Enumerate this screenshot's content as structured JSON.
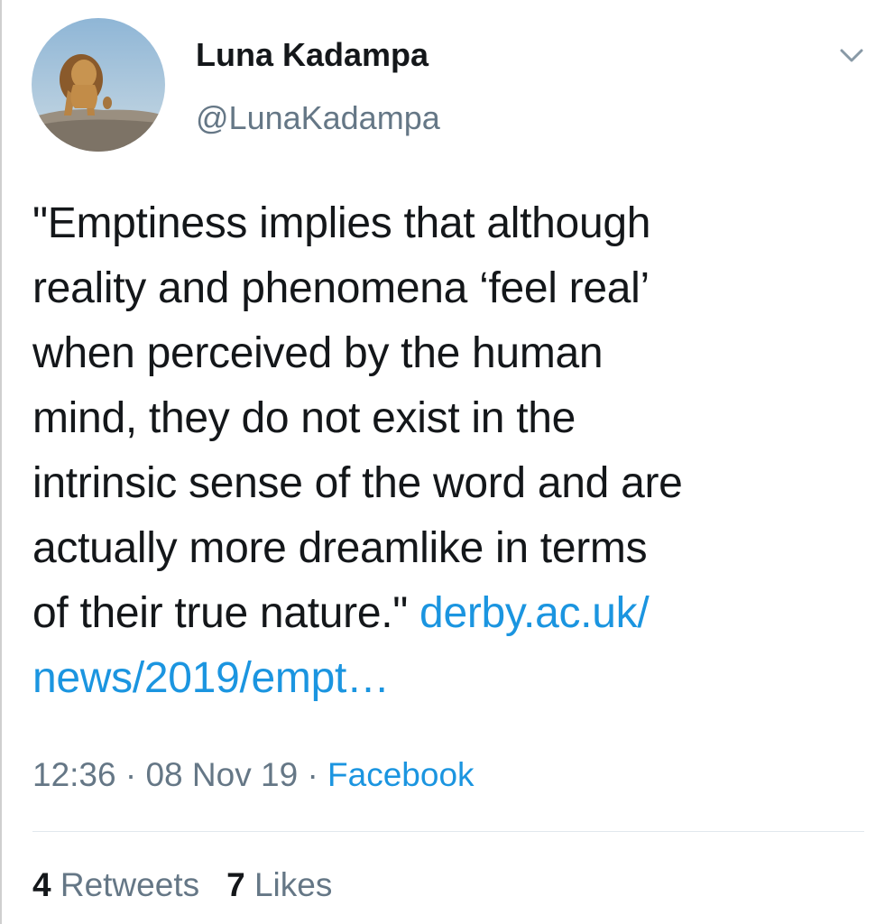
{
  "author": {
    "display_name": "Luna Kadampa",
    "handle": "@LunaKadampa",
    "avatar_icon": "lion-photo-avatar"
  },
  "menu_icon": "chevron-down-icon",
  "tweet": {
    "lines": [
      "\"Emptiness implies that although",
      "reality and phenomena ‘feel real’",
      "when perceived by the human",
      "mind, they do not exist in the",
      "intrinsic sense of the word and are",
      "actually more dreamlike in terms",
      "of their true nature.\" "
    ],
    "link_part1": "derby.ac.uk/",
    "link_part2": "news/2019/empt…"
  },
  "meta": {
    "time": "12:36",
    "separator": "·",
    "date": "08 Nov 19",
    "source": "Facebook"
  },
  "stats": {
    "retweets_count": "4",
    "retweets_label": "Retweets",
    "likes_count": "7",
    "likes_label": "Likes"
  },
  "colors": {
    "link": "#1b95e0",
    "secondary_text": "#657786",
    "primary_text": "#14171a"
  }
}
